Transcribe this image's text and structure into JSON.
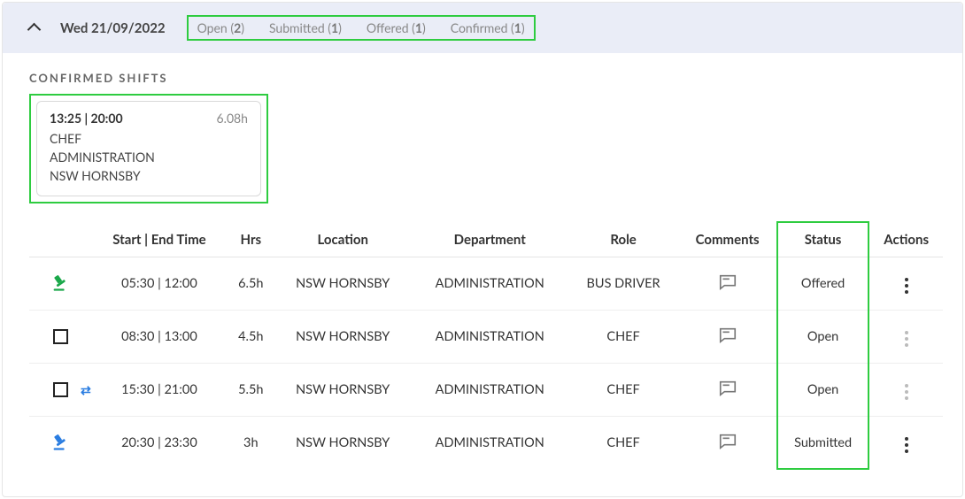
{
  "header": {
    "date": "Wed 21/09/2022",
    "badges": [
      {
        "label": "Open",
        "count": "2"
      },
      {
        "label": "Submitted",
        "count": "1"
      },
      {
        "label": "Offered",
        "count": "1"
      },
      {
        "label": "Confirmed",
        "count": "1"
      }
    ]
  },
  "confirmed": {
    "title": "CONFIRMED SHIFTS",
    "card": {
      "time": "13:25 | 20:00",
      "hours": "6.08h",
      "role": "CHEF",
      "department": "ADMINISTRATION",
      "location": "NSW HORNSBY"
    }
  },
  "table": {
    "headers": {
      "time": "Start | End Time",
      "hrs": "Hrs",
      "location": "Location",
      "department": "Department",
      "role": "Role",
      "comments": "Comments",
      "status": "Status",
      "actions": "Actions"
    },
    "rows": [
      {
        "lead": "gavel-green",
        "time": "05:30 | 12:00",
        "hrs": "6.5h",
        "location": "NSW HORNSBY",
        "department": "ADMINISTRATION",
        "role": "BUS DRIVER",
        "status": "Offered",
        "actions_enabled": true,
        "swap": false
      },
      {
        "lead": "checkbox",
        "time": "08:30 | 13:00",
        "hrs": "4.5h",
        "location": "NSW HORNSBY",
        "department": "ADMINISTRATION",
        "role": "CHEF",
        "status": "Open",
        "actions_enabled": false,
        "swap": false
      },
      {
        "lead": "checkbox",
        "time": "15:30 | 21:00",
        "hrs": "5.5h",
        "location": "NSW HORNSBY",
        "department": "ADMINISTRATION",
        "role": "CHEF",
        "status": "Open",
        "actions_enabled": false,
        "swap": true
      },
      {
        "lead": "gavel-blue",
        "time": "20:30 | 23:30",
        "hrs": "3h",
        "location": "NSW HORNSBY",
        "department": "ADMINISTRATION",
        "role": "CHEF",
        "status": "Submitted",
        "actions_enabled": true,
        "swap": false
      }
    ]
  }
}
